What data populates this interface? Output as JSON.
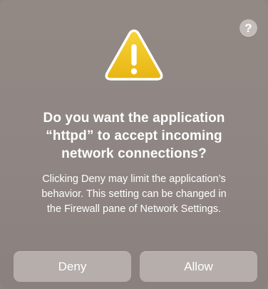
{
  "dialog": {
    "help_label": "?",
    "icon": "warning-triangle-icon",
    "title_lines": [
      "Do you want the application",
      "“httpd” to accept incoming",
      "network connections?"
    ],
    "body_lines": [
      "Clicking Deny may limit the application’s",
      "behavior. This setting can be changed in",
      "the Firewall pane of Network Settings."
    ],
    "buttons": {
      "deny": "Deny",
      "allow": "Allow"
    },
    "colors": {
      "background": "#8f8683",
      "button": "#b5aeab",
      "warning_yellow": "#f2c21b",
      "text": "#ffffff"
    }
  }
}
